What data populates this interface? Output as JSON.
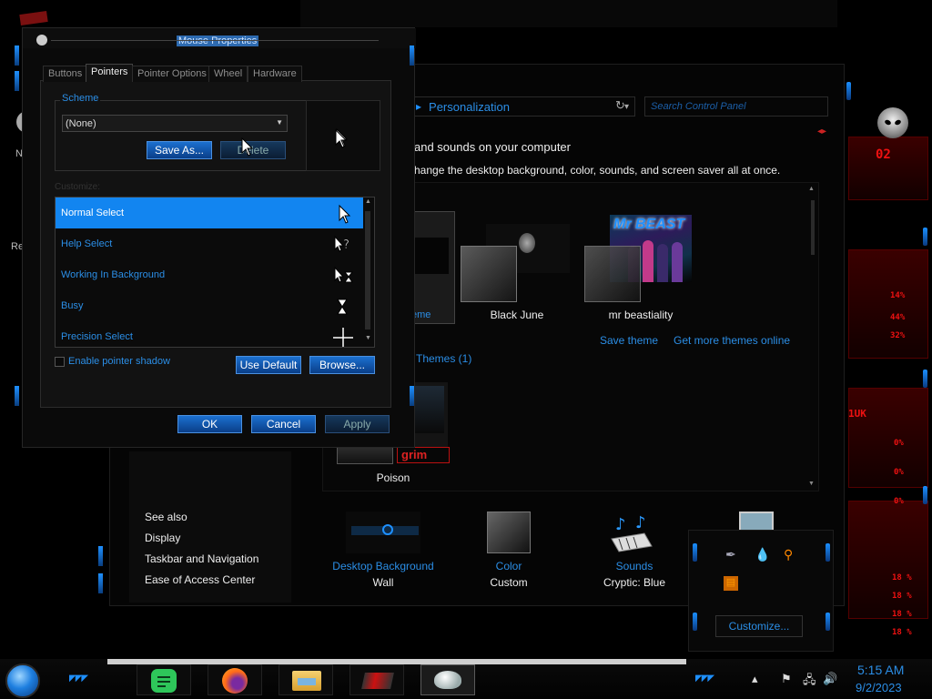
{
  "dialog": {
    "title": "Mouse Properties",
    "tabs": [
      "Buttons",
      "Pointers",
      "Pointer Options",
      "Wheel",
      "Hardware"
    ],
    "active_tab": "Pointers",
    "scheme_label": "Scheme",
    "scheme_value": "(None)",
    "save_as": "Save As...",
    "delete": "Delete",
    "customize_label": "Customize:",
    "cursors": [
      {
        "name": "Normal Select",
        "icon": "arrow-cursor-icon"
      },
      {
        "name": "Help Select",
        "icon": "help-cursor-icon"
      },
      {
        "name": "Working In Background",
        "icon": "working-cursor-icon"
      },
      {
        "name": "Busy",
        "icon": "hourglass-cursor-icon"
      },
      {
        "name": "Precision Select",
        "icon": "crosshair-cursor-icon"
      }
    ],
    "selected_cursor": "Normal Select",
    "enable_shadow": "Enable pointer shadow",
    "use_default": "Use Default",
    "browse": "Browse...",
    "ok": "OK",
    "cancel": "Cancel",
    "apply": "Apply"
  },
  "control_panel": {
    "address": "Personalization",
    "search_placeholder": "Search Control Panel",
    "heading": "and sounds on your computer",
    "subheading": "hange the desktop background, color, sounds, and screen saver all at once.",
    "selected_theme_fragment": "eme",
    "themes": [
      {
        "name": "Black June"
      },
      {
        "name": "mr beastiality",
        "thumb_text": "Mr BEAST"
      },
      {
        "name": "Poison",
        "badge": "grim"
      }
    ],
    "save_theme": "Save theme",
    "get_more": "Get more themes online",
    "installed_themes": "Themes (1)",
    "see_also": [
      "See also",
      "Display",
      "Taskbar and Navigation",
      "Ease of Access Center"
    ],
    "bottom": [
      {
        "label": "Desktop Background",
        "value": "Wall"
      },
      {
        "label": "Color",
        "value": "Custom"
      },
      {
        "label": "Sounds",
        "value": "Cryptic: Blue"
      }
    ]
  },
  "tray_popup": {
    "customize": "Customize..."
  },
  "taskbar": {
    "time": "5:15 AM",
    "date": "9/2/2023"
  },
  "deco": {
    "numbers": [
      "14%",
      "44%",
      "32%",
      "0%",
      "0%",
      "0%",
      "18 %",
      "18 %",
      "18 %",
      "18 %"
    ],
    "top_text": "02",
    "red_label": "1UK"
  },
  "left_fragments": [
    "N",
    "Re"
  ],
  "colors": {
    "accent": "#2b8ee6",
    "selection": "#1285f0",
    "alert": "#dd2222"
  }
}
